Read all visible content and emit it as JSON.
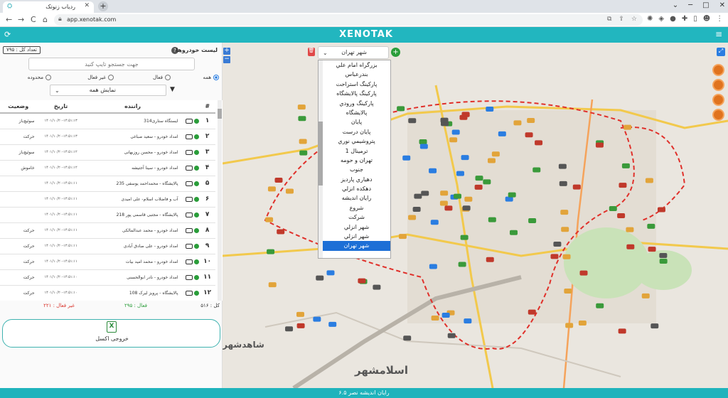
{
  "browser": {
    "tab_title": "ردیاب زنوتک",
    "url": "app.xenotak.com",
    "new_tab": "+",
    "nav": {
      "back": "←",
      "forward": "→",
      "reload": "C"
    }
  },
  "app": {
    "logo": "XENOTAK",
    "footer": "رایان اندیشه نصر ۶.۵",
    "accent_color": "#22b6bf"
  },
  "sidebar": {
    "count_badge": "تعداد کل : ۷۹۵",
    "title": "لیست خودروها",
    "search_placeholder": "جهت جستجو تایپ کنید",
    "radios": [
      {
        "label": "همه",
        "checked": true
      },
      {
        "label": "فعال",
        "checked": false
      },
      {
        "label": "غیر فعال",
        "checked": false
      },
      {
        "label": "محدوده",
        "checked": false
      }
    ],
    "display_select": "نمایش همه",
    "table": {
      "headers": [
        "#",
        "",
        "راننده",
        "تاریخ",
        "وضعیت"
      ],
      "rows": [
        {
          "num": "۱",
          "driver": "ایستگاه ستاری314",
          "date": "۱۴۰۱/۱۰/۲۰-۱۴:۵۱:۱۳",
          "status": "سوئیچ‌باز"
        },
        {
          "num": "۲",
          "driver": "امداد خودرو - سعید صباغی",
          "date": "۱۴۰۱/۱۰/۲۰-۱۴:۵۱:۱۳",
          "status": "حرکت"
        },
        {
          "num": "۳",
          "driver": "امداد خودرو - محسن روزبهانی",
          "date": "۱۴۰۱/۱۰/۲۰-۱۴:۵۱:۱۲",
          "status": "سوئیچ‌باز"
        },
        {
          "num": "۴",
          "driver": "امداد خودرو - سینا آجتیشه",
          "date": "۱۴۰۱/۱۰/۲۰-۱۴:۵۱:۱۲",
          "status": "خاموش"
        },
        {
          "num": "۵",
          "driver": "پالایشگاه - محمداحمد یوسفی 235",
          "date": "۱۴۰۱/۱۰/۲۰-۱۴:۵۱:۱۱",
          "status": ""
        },
        {
          "num": "۶",
          "driver": "آب و فاضلاب اسلام- علی امیدی",
          "date": "۱۴۰۱/۱۰/۲۰-۱۴:۵۱:۱۱",
          "status": ""
        },
        {
          "num": "۷",
          "driver": "پالایشگاه - مجتبی قاسمی پور 218",
          "date": "۱۴۰۱/۱۰/۲۰-۱۴:۵۱:۱۱",
          "status": ""
        },
        {
          "num": "۸",
          "driver": "امداد خودرو - محمد عبدالمالکی",
          "date": "۱۴۰۱/۱۰/۲۰-۱۴:۵۱:۱۱",
          "status": "حرکت"
        },
        {
          "num": "۹",
          "driver": "امداد خودرو - علی صادق آبادی",
          "date": "۱۴۰۱/۱۰/۲۰-۱۴:۵۱:۱۱",
          "status": "حرکت"
        },
        {
          "num": "۱۰",
          "driver": "امداد خودرو - محمد امید بیات",
          "date": "۱۴۰۱/۱۰/۲۰-۱۴:۵۱:۱۱",
          "status": "حرکت"
        },
        {
          "num": "۱۱",
          "driver": "امداد خودرو - نادر ابوالحسنی",
          "date": "۱۴۰۱/۱۰/۲۰-۱۴:۵۱:۱۰",
          "status": "حرکت"
        },
        {
          "num": "۱۲",
          "driver": "پالایشگاه - پرویز لیرک 108",
          "date": "۱۴۰۱/۱۰/۲۰-۱۴:۵۱:۱۰",
          "status": "حرکت"
        }
      ]
    },
    "totals": {
      "all": "کل : ۵۱۶",
      "active": "فعال : ۲۹۵",
      "inactive": "غیر فعال : ۲۲۱"
    },
    "export_label": "خروجی اکسل"
  },
  "map": {
    "selected_city": "شهر تهران",
    "cities": [
      "بزرگراه امام علي",
      "بندرعباس",
      "پارکينگ استراحت",
      "پارکينگ پالايشگاه",
      "پارکينگ ورودي",
      "پالايشگاه",
      "پايان",
      "پايان درست",
      "پتروشيمي نوري",
      "ترمينال 1",
      "تهران و حومه",
      "جنوب",
      "دهياري پارديز",
      "دهکده انزلي",
      "رايان انديشه",
      "شروع",
      "شرکت",
      "شهر انزلي",
      "شهر انزلي",
      "شهر تهران"
    ],
    "labels": [
      {
        "text": "اسلامشهر"
      },
      {
        "text": "شاهدشهر"
      }
    ],
    "side_buttons": [
      "building-icon",
      "layers-icon",
      "document-icon",
      "car-icon"
    ]
  }
}
